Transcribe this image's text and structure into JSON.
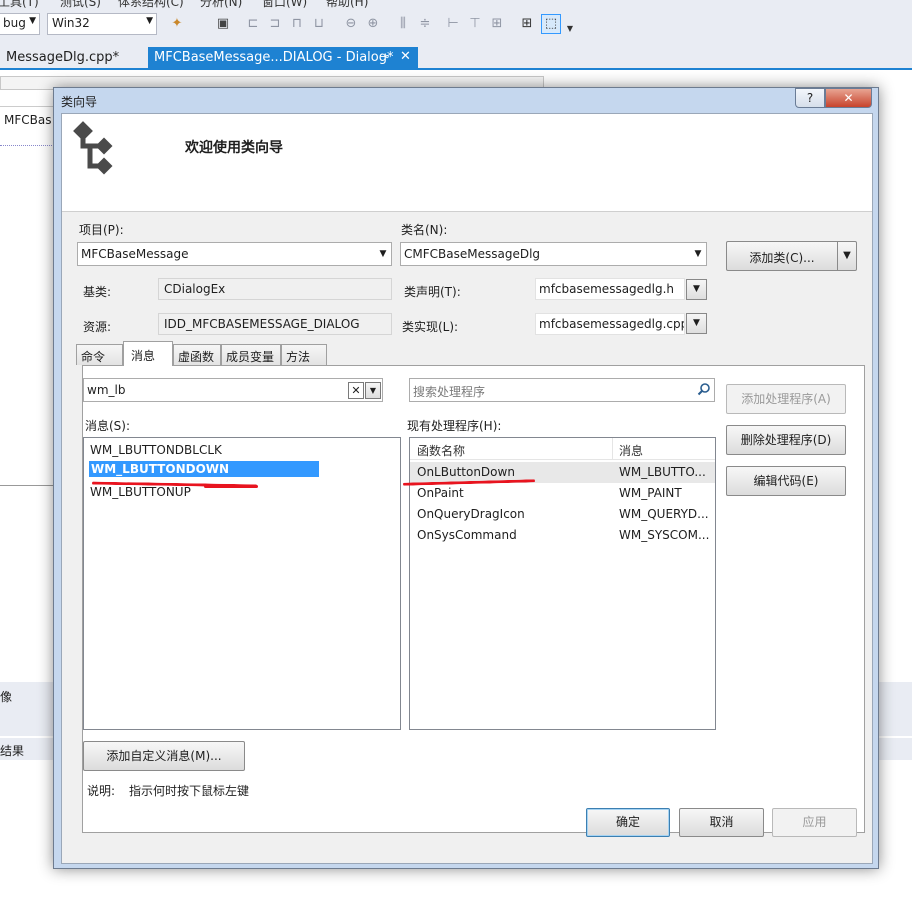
{
  "ide": {
    "menubar": [
      "工具(T)",
      "测试(S)",
      "体系结构(C)",
      "分析(N)",
      "窗口(W)",
      "帮助(H)"
    ],
    "config_combo": "bug",
    "platform_combo": "Win32",
    "tabs": [
      {
        "label": "MessageDlg.cpp*"
      },
      {
        "label": "MFCBaseMessage...DIALOG - Dialog*"
      }
    ],
    "left_panel_label": "MFCBas",
    "bottom_label_1": "像",
    "bottom_label_2": "结果"
  },
  "dialog": {
    "title": "类向导",
    "help_label": "?",
    "close_label": "✕",
    "header_title": "欢迎使用类向导",
    "project_label": "项目(P):",
    "project_value": "MFCBaseMessage",
    "classname_label": "类名(N):",
    "classname_value": "CMFCBaseMessageDlg",
    "add_class_label": "添加类(C)...",
    "base_label": "基类:",
    "base_value": "CDialogEx",
    "resource_label": "资源:",
    "resource_value": "IDD_MFCBASEMESSAGE_DIALOG",
    "decl_label": "类声明(T):",
    "decl_value": "mfcbasemessagedlg.h",
    "impl_label": "类实现(L):",
    "impl_value": "mfcbasemessagedlg.cpp",
    "tabs": [
      "命令",
      "消息",
      "虚函数",
      "成员变量",
      "方法"
    ],
    "filter_value": "wm_lb",
    "clear_label": "✕",
    "handler_search_placeholder": "搜索处理程序",
    "messages_label": "消息(S):",
    "messages": [
      "WM_LBUTTONDBLCLK",
      "WM_LBUTTONDOWN",
      "WM_LBUTTONUP"
    ],
    "handlers_label": "现有处理程序(H):",
    "handler_columns": [
      "函数名称",
      "消息"
    ],
    "handlers": [
      {
        "name": "OnLButtonDown",
        "msg": "WM_LBUTTO..."
      },
      {
        "name": "OnPaint",
        "msg": "WM_PAINT"
      },
      {
        "name": "OnQueryDragIcon",
        "msg": "WM_QUERYD..."
      },
      {
        "name": "OnSysCommand",
        "msg": "WM_SYSCOM..."
      }
    ],
    "add_handler_label": "添加处理程序(A)",
    "delete_handler_label": "删除处理程序(D)",
    "edit_code_label": "编辑代码(E)",
    "add_custom_msg_label": "添加自定义消息(M)...",
    "desc_label": "说明:",
    "desc_value": "指示何时按下鼠标左键",
    "ok_label": "确定",
    "cancel_label": "取消",
    "apply_label": "应用"
  }
}
